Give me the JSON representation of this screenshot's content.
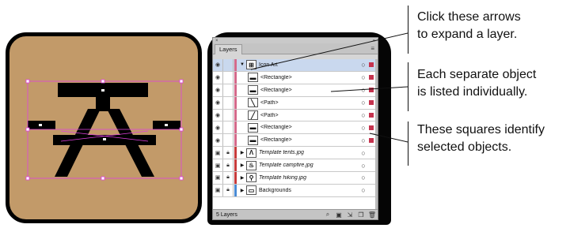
{
  "panel": {
    "tab_label": "Layers",
    "footer_label": "5 Layers",
    "rows": [
      {
        "name": "Icon Art",
        "thumb": "⊞",
        "italic": false,
        "expanded": true,
        "selected": true,
        "lock": false,
        "bar": "#d46a8b",
        "sel_color": "#c5334e",
        "indent": 0
      },
      {
        "name": "<Rectangle>",
        "thumb": "▬",
        "italic": false,
        "expanded": false,
        "selected": false,
        "lock": false,
        "bar": "#d46a8b",
        "sel_color": "#c5334e",
        "indent": 1
      },
      {
        "name": "<Rectangle>",
        "thumb": "▬",
        "italic": false,
        "expanded": false,
        "selected": false,
        "lock": false,
        "bar": "#d46a8b",
        "sel_color": "#c5334e",
        "indent": 1
      },
      {
        "name": "<Path>",
        "thumb": "╲",
        "italic": false,
        "expanded": false,
        "selected": false,
        "lock": false,
        "bar": "#d46a8b",
        "sel_color": "#c5334e",
        "indent": 1
      },
      {
        "name": "<Path>",
        "thumb": "╱",
        "italic": false,
        "expanded": false,
        "selected": false,
        "lock": false,
        "bar": "#d46a8b",
        "sel_color": "#c5334e",
        "indent": 1
      },
      {
        "name": "<Rectangle>",
        "thumb": "▬",
        "italic": false,
        "expanded": false,
        "selected": false,
        "lock": false,
        "bar": "#d46a8b",
        "sel_color": "#c5334e",
        "indent": 1
      },
      {
        "name": "<Rectangle>",
        "thumb": "▬",
        "italic": false,
        "expanded": false,
        "selected": false,
        "lock": false,
        "bar": "#d46a8b",
        "sel_color": "#c5334e",
        "indent": 1
      },
      {
        "name": "Template tents.jpg",
        "thumb": "Λ",
        "italic": true,
        "expanded": false,
        "selected": false,
        "lock": true,
        "bar": "#c83c3c",
        "sel_color": "",
        "indent": 0
      },
      {
        "name": "Template campfire.jpg",
        "thumb": "♨",
        "italic": true,
        "expanded": false,
        "selected": false,
        "lock": true,
        "bar": "#c83c3c",
        "sel_color": "",
        "indent": 0
      },
      {
        "name": "Template hiking.jpg",
        "thumb": "⚲",
        "italic": true,
        "expanded": false,
        "selected": false,
        "lock": true,
        "bar": "#c83c3c",
        "sel_color": "",
        "indent": 0
      },
      {
        "name": "Backgrounds",
        "thumb": "▭",
        "italic": false,
        "expanded": false,
        "selected": false,
        "lock": true,
        "bar": "#4a8bd4",
        "sel_color": "",
        "indent": 0
      }
    ]
  },
  "callouts": {
    "expand": [
      "Click these arrows",
      "to expand a layer."
    ],
    "listed": [
      "Each separate object",
      "is listed individually."
    ],
    "selected": [
      "These squares identify",
      "selected objects."
    ]
  },
  "colors": {
    "icon_bg": "#c29a69",
    "selection_outline": "#e040e0"
  },
  "icons": [
    "eye-icon",
    "lock-icon",
    "expand-arrow-icon",
    "search-icon",
    "new-sublayer-icon",
    "new-layer-icon",
    "delete-icon",
    "make-clipping-mask-icon"
  ]
}
